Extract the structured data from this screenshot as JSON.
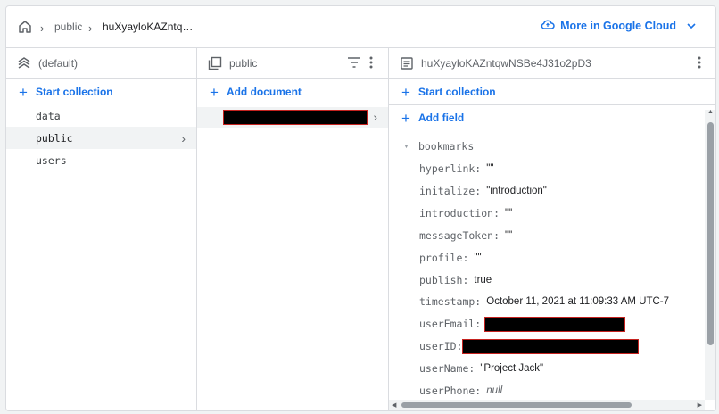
{
  "breadcrumb": {
    "home_icon": "home-icon",
    "items": [
      "public",
      "huXyayloKAZntq…"
    ]
  },
  "cloud_button": {
    "label": "More in Google Cloud",
    "icon": "cloud-icon"
  },
  "col1": {
    "header": "(default)",
    "action": "Start collection",
    "items": [
      "data",
      "public",
      "users"
    ],
    "selected": "public"
  },
  "col2": {
    "header": "public",
    "action": "Add document"
  },
  "col3": {
    "header": "huXyayloKAZntqwNSBe4J31o2pD3",
    "action1": "Start collection",
    "action2": "Add field",
    "map_name": "bookmarks",
    "fields": [
      {
        "key": "hyperlink:",
        "value": "\"\""
      },
      {
        "key": "initalize:",
        "value": "\"introduction\""
      },
      {
        "key": "introduction:",
        "value": "\"\""
      },
      {
        "key": "messageToken:",
        "value": "\"\""
      },
      {
        "key": "profile:",
        "value": "\"\""
      },
      {
        "key": "publish:",
        "value": "true"
      },
      {
        "key": "timestamp:",
        "value": "October 11, 2021 at 11:09:33 AM UTC-7"
      },
      {
        "key": "userEmail:",
        "value": ""
      },
      {
        "key": "userID:",
        "value": ""
      },
      {
        "key": "userName:",
        "value": "\"Project Jack\""
      },
      {
        "key": "userPhone:",
        "value": "null"
      }
    ]
  },
  "colors": {
    "accent": "#1a73e8",
    "redaction": "#000000",
    "redaction_border": "#c5221f"
  }
}
